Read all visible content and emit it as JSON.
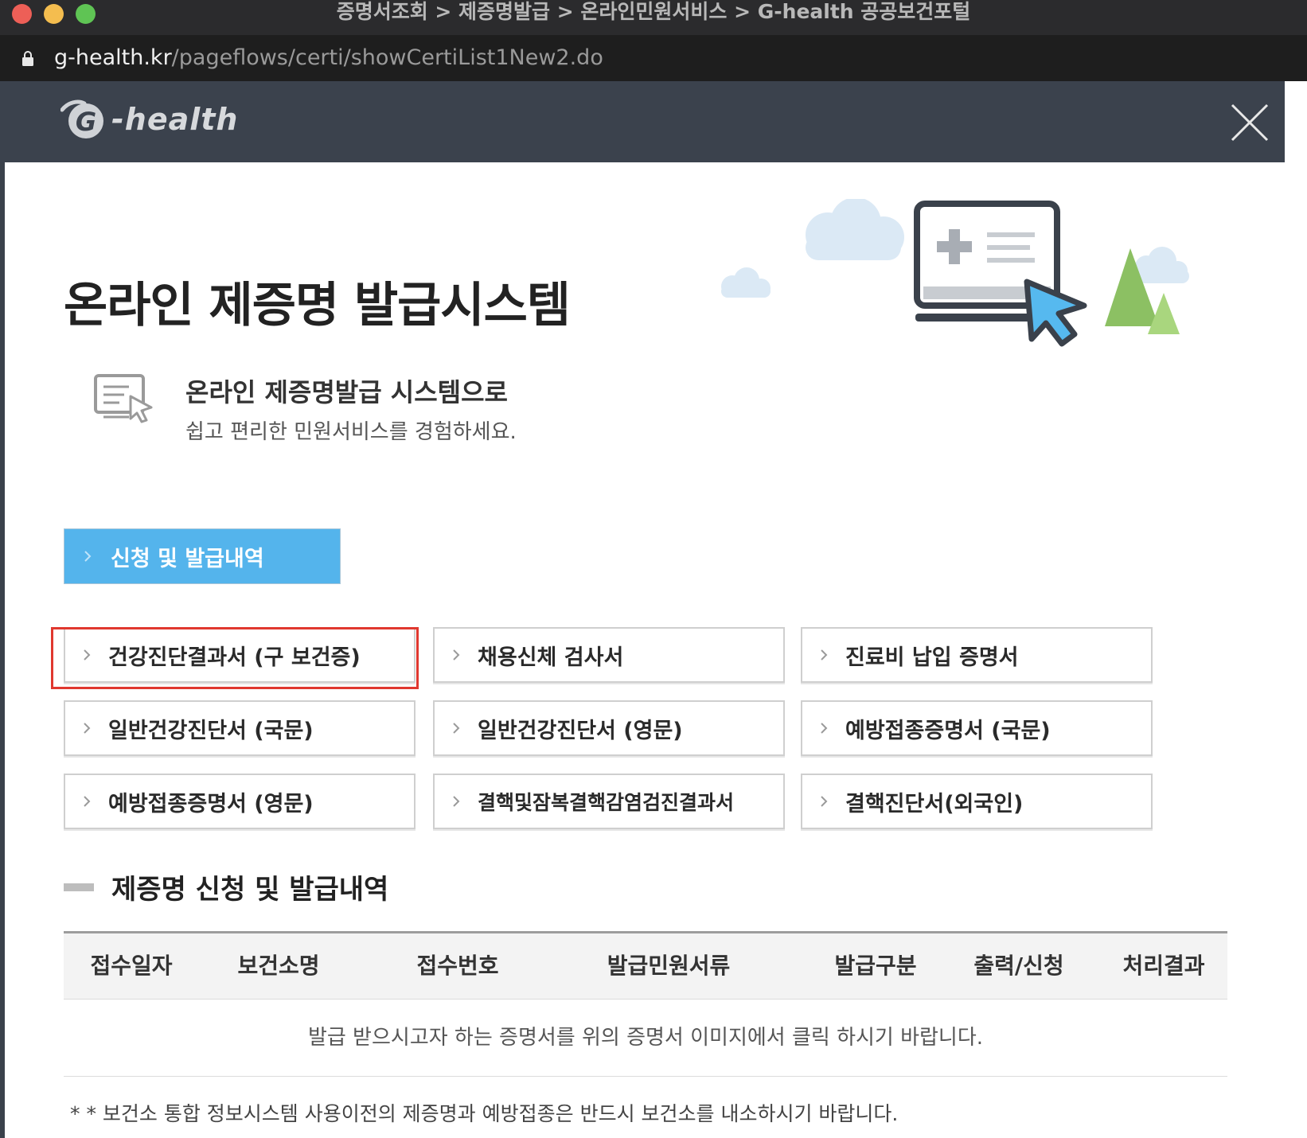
{
  "window": {
    "title": "증명서조회 > 제증명발급 > 온라인민원서비스 > G-health 공공보건포털",
    "url_host": "g-health.kr",
    "url_path": "/pageflows/certi/showCertiList1New2.do"
  },
  "header": {
    "logo_text": "-health"
  },
  "hero": {
    "title": "온라인 제증명 발급시스템",
    "intro_heading": "온라인 제증명발급 시스템으로",
    "intro_sub": "쉽고 편리한 민원서비스를 경험하세요."
  },
  "tab": {
    "label": "신청 및 발급내역"
  },
  "certificates": [
    {
      "label": "건강진단결과서 (구 보건증)"
    },
    {
      "label": "채용신체 검사서"
    },
    {
      "label": "진료비 납입 증명서"
    },
    {
      "label": "일반건강진단서 (국문)"
    },
    {
      "label": "일반건강진단서 (영문)"
    },
    {
      "label": "예방접종증명서 (국문)"
    },
    {
      "label": "예방접종증명서 (영문)"
    },
    {
      "label": "결핵및잠복결핵감염검진결과서"
    },
    {
      "label": "결핵진단서(외국인)"
    }
  ],
  "section": {
    "title": "제증명 신청 및 발급내역"
  },
  "table": {
    "columns": [
      "접수일자",
      "보건소명",
      "접수번호",
      "발급민원서류",
      "발급구분",
      "출력/신청",
      "처리결과"
    ],
    "empty_message": "발급 받으시고자 하는 증명서를 위의 증명서 이미지에서 클릭 하시기 바랍니다."
  },
  "footnote": "* * 보건소 통합 정보시스템 사용이전의 제증명과 예방접종은 반드시 보건소를 내소하시기 바랍니다.",
  "colors": {
    "header_bg": "#3b424d",
    "tab_blue": "#54b4ec",
    "highlight_red": "#e0382f"
  }
}
